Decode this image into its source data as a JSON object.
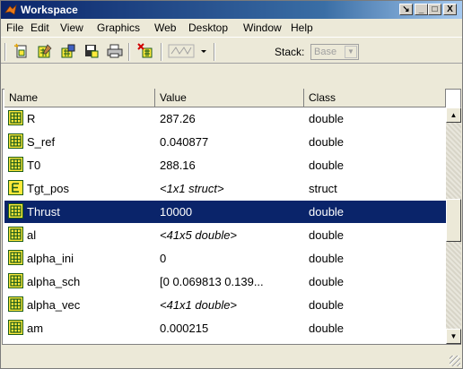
{
  "window": {
    "title": "Workspace",
    "controls": {
      "dock": "↘",
      "minimize": "_",
      "maximize": "□",
      "close": "X"
    }
  },
  "menubar": {
    "items": [
      "File",
      "Edit",
      "View",
      "Graphics",
      "Web",
      "Desktop",
      "Window",
      "Help"
    ]
  },
  "toolbar": {
    "tools": [
      "new-variable-icon",
      "open-variable-icon",
      "load-data-icon",
      "save-workspace-icon",
      "print-icon",
      "delete-icon",
      "plot-icon",
      "plot-dropdown-icon"
    ],
    "stack_label": "Stack:",
    "stack_value": "Base"
  },
  "table": {
    "columns": [
      "Name",
      "Value",
      "Class"
    ],
    "rows": [
      {
        "name": "R",
        "value": "287.26",
        "class": "double",
        "icon": "array-icon",
        "italic": false
      },
      {
        "name": "S_ref",
        "value": "0.040877",
        "class": "double",
        "icon": "array-icon",
        "italic": false
      },
      {
        "name": "T0",
        "value": "288.16",
        "class": "double",
        "icon": "array-icon",
        "italic": false
      },
      {
        "name": "Tgt_pos",
        "value": "<1x1 struct>",
        "class": "struct",
        "icon": "struct-icon",
        "italic": true
      },
      {
        "name": "Thrust",
        "value": "10000",
        "class": "double",
        "icon": "array-icon",
        "italic": false,
        "selected": true
      },
      {
        "name": "al",
        "value": "<41x5 double>",
        "class": "double",
        "icon": "array-icon",
        "italic": true
      },
      {
        "name": "alpha_ini",
        "value": "0",
        "class": "double",
        "icon": "array-icon",
        "italic": false
      },
      {
        "name": "alpha_sch",
        "value": "[0 0.069813 0.139...",
        "class": "double",
        "icon": "array-icon",
        "italic": false
      },
      {
        "name": "alpha_vec",
        "value": "<41x1 double>",
        "class": "double",
        "icon": "array-icon",
        "italic": true
      },
      {
        "name": "am",
        "value": "0.000215",
        "class": "double",
        "icon": "array-icon",
        "italic": false
      }
    ]
  },
  "colors": {
    "selection": "#0a246a",
    "icon_fill": "#ffe93a",
    "icon_border": "#1a5c1a"
  }
}
